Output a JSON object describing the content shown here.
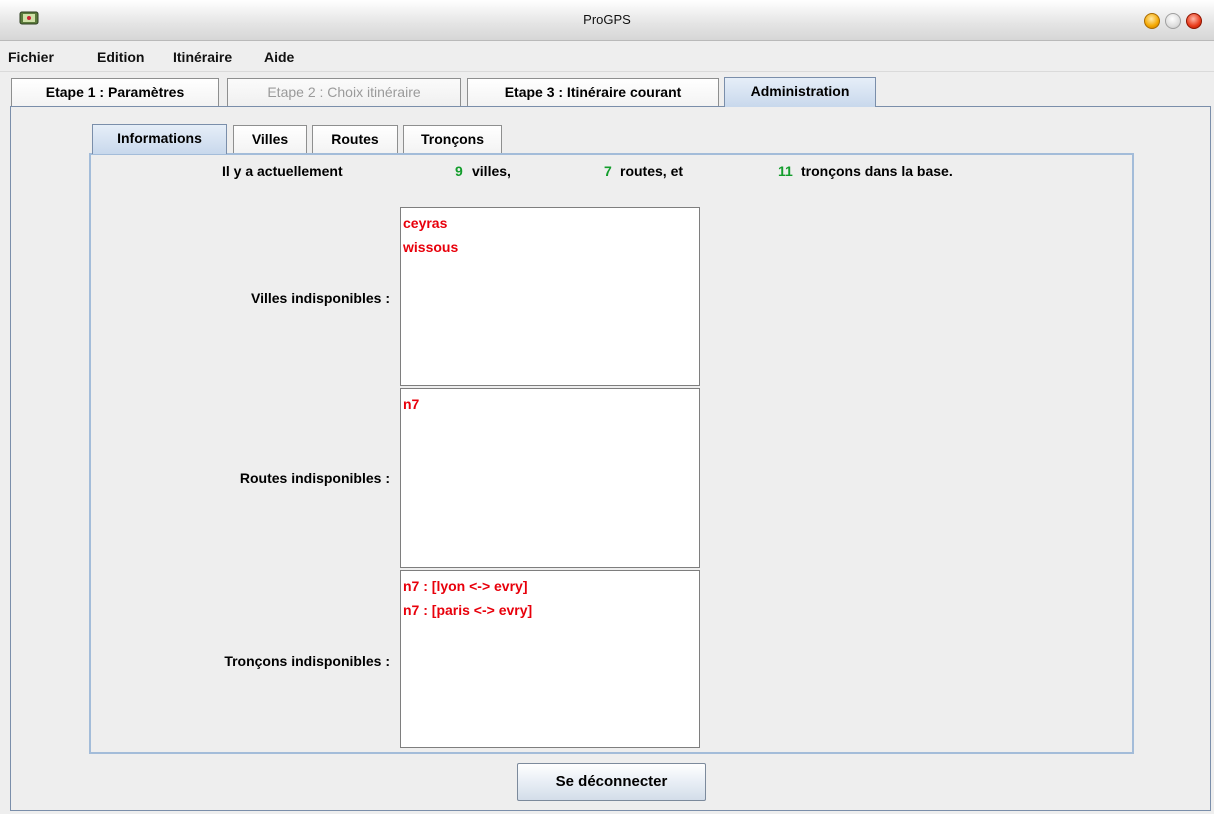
{
  "window": {
    "title": "ProGPS"
  },
  "menu": [
    "Fichier",
    "Edition",
    "Itinéraire",
    "Aide"
  ],
  "top_tabs": [
    {
      "label": "Etape 1 : Paramètres",
      "state": "normal"
    },
    {
      "label": "Etape 2 : Choix itinéraire",
      "state": "disabled"
    },
    {
      "label": "Etape 3 : Itinéraire courant",
      "state": "normal"
    },
    {
      "label": "Administration",
      "state": "active"
    }
  ],
  "inner_tabs": [
    {
      "label": "Informations",
      "state": "active"
    },
    {
      "label": "Villes",
      "state": "normal"
    },
    {
      "label": "Routes",
      "state": "normal"
    },
    {
      "label": "Tronçons",
      "state": "normal"
    }
  ],
  "summary": {
    "prefix": "Il y a actuellement",
    "villes_count": "9",
    "villes_label": "villes,",
    "routes_count": "7",
    "routes_label": "routes, et",
    "troncons_count": "11",
    "troncons_label": "tronçons dans la base."
  },
  "sections": {
    "villes": {
      "label": "Villes indisponibles :",
      "items": [
        "ceyras",
        "wissous"
      ]
    },
    "routes": {
      "label": "Routes indisponibles :",
      "items": [
        "n7"
      ]
    },
    "troncons": {
      "label": "Tronçons indisponibles :",
      "items": [
        "n7 : [lyon <-> evry]",
        "n7 : [paris <-> evry]"
      ]
    }
  },
  "buttons": {
    "disconnect": "Se déconnecter"
  },
  "colors": {
    "count": "#139d2c",
    "unavailable": "#e8000b",
    "active_tab": "#c8d8ec"
  }
}
